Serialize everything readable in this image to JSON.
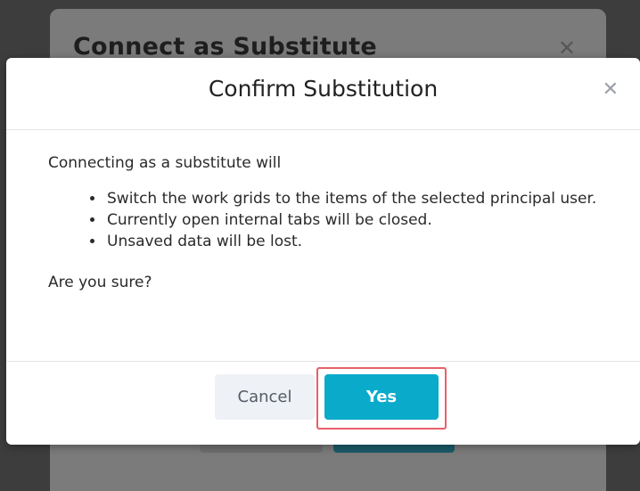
{
  "background_dialog": {
    "title": "Connect as Substitute",
    "close_icon": "close-icon"
  },
  "dialog": {
    "title": "Confirm Substitution",
    "close_icon": "close-icon",
    "intro": "Connecting as a substitute will",
    "bullets": [
      "Switch the work grids to the items of the selected principal user.",
      "Currently open internal tabs will be closed.",
      "Unsaved data will be lost."
    ],
    "question": "Are you sure?",
    "buttons": {
      "cancel_label": "Cancel",
      "yes_label": "Yes"
    }
  },
  "colors": {
    "primary": "#0aaacb",
    "highlight": "#e8606a",
    "overlay": "#3d3d3d"
  }
}
